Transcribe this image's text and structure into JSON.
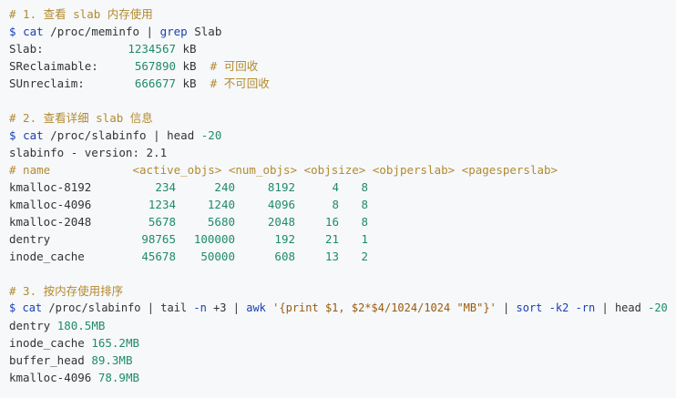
{
  "section1": {
    "comment": "# 1. 查看 slab 内存使用",
    "cmd": {
      "prompt": "$",
      "cat": "cat",
      "path": "/proc/meminfo",
      "pipe": "|",
      "grep": "grep",
      "arg": "Slab"
    },
    "rows": [
      {
        "key": "Slab:",
        "value": "1234567",
        "unit": "kB",
        "comment": ""
      },
      {
        "key": "SReclaimable:",
        "value": "567890",
        "unit": "kB",
        "comment": "# 可回收"
      },
      {
        "key": "SUnreclaim:",
        "value": "666677",
        "unit": "kB",
        "comment": "# 不可回收"
      }
    ]
  },
  "section2": {
    "comment": "# 2. 查看详细 slab 信息",
    "cmd": {
      "prompt": "$",
      "cat": "cat",
      "path": "/proc/slabinfo",
      "pipe": "|",
      "head": "head",
      "arg": "-20"
    },
    "version": "slabinfo - version: 2.1",
    "header": "# name            <active_objs> <num_objs> <objsize> <objperslab> <pagesperslab>",
    "rows": [
      {
        "name": "kmalloc-8192",
        "active": "234",
        "num": "240",
        "size": "8192",
        "perslab": "4",
        "pages": "8"
      },
      {
        "name": "kmalloc-4096",
        "active": "1234",
        "num": "1240",
        "size": "4096",
        "perslab": "8",
        "pages": "8"
      },
      {
        "name": "kmalloc-2048",
        "active": "5678",
        "num": "5680",
        "size": "2048",
        "perslab": "16",
        "pages": "8"
      },
      {
        "name": "dentry",
        "active": "98765",
        "num": "100000",
        "size": "192",
        "perslab": "21",
        "pages": "1"
      },
      {
        "name": "inode_cache",
        "active": "45678",
        "num": "50000",
        "size": "608",
        "perslab": "13",
        "pages": "2"
      }
    ]
  },
  "section3": {
    "comment": "# 3. 按内存使用排序",
    "cmd": {
      "prompt": "$",
      "cat": "cat",
      "path": "/proc/slabinfo",
      "pipe1": "|",
      "tail": "tail",
      "tail_n": "-n",
      "tail_arg": "+3",
      "pipe2": "|",
      "awk": "awk",
      "awk_prog": "'{print $1, $2*$4/1024/1024 \"MB\"}'",
      "pipe3": "|",
      "sort": "sort",
      "sort_k": "-k2",
      "sort_rn": "-rn",
      "pipe4": "|",
      "head": "head",
      "head_arg": "-20"
    },
    "rows": [
      {
        "name": "dentry",
        "value": "180.5MB"
      },
      {
        "name": "inode_cache",
        "value": "165.2MB"
      },
      {
        "name": "buffer_head",
        "value": "89.3MB"
      },
      {
        "name": "kmalloc-4096",
        "value": "78.9MB"
      }
    ]
  }
}
